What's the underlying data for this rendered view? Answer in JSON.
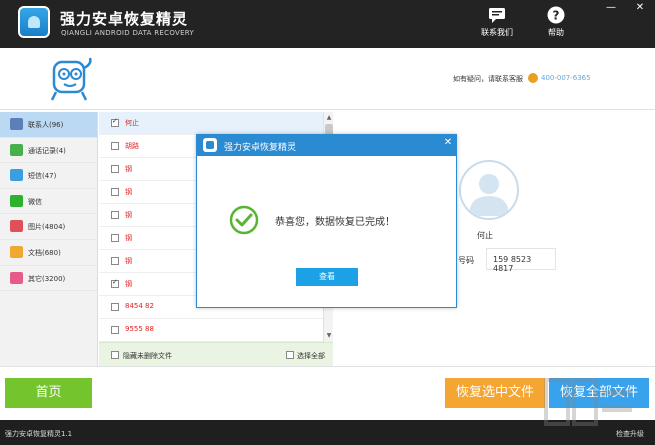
{
  "app": {
    "title": "强力安卓恢复精灵",
    "subtitle": "QIANGLI ANDROID DATA RECOVERY",
    "contact_label": "联系我们",
    "help_label": "帮助",
    "minimize": "—",
    "close": "✕"
  },
  "header": {
    "help_text": "如有疑问，请联系客服",
    "phone": "400-007-6365"
  },
  "sidebar": {
    "items": [
      {
        "label": "联系人(96)",
        "icon": "contacts-icon",
        "color": "#5b7fb8"
      },
      {
        "label": "通话记录(4)",
        "icon": "call-log-icon",
        "color": "#47b04b"
      },
      {
        "label": "短信(47)",
        "icon": "sms-icon",
        "color": "#3a9ee0"
      },
      {
        "label": "微信",
        "icon": "wechat-icon",
        "color": "#2fb12f"
      },
      {
        "label": "图片(4804)",
        "icon": "photos-icon",
        "color": "#e0505a"
      },
      {
        "label": "文档(680)",
        "icon": "documents-icon",
        "color": "#f0a830"
      },
      {
        "label": "其它(3200)",
        "icon": "others-icon",
        "color": "#e85a8a"
      }
    ]
  },
  "list": {
    "rows": [
      {
        "name": "何止",
        "checked": true
      },
      {
        "name": "胡路",
        "checked": false
      },
      {
        "name": "钢",
        "checked": false
      },
      {
        "name": "钢",
        "checked": false
      },
      {
        "name": "钢",
        "checked": false
      },
      {
        "name": "钢",
        "checked": false
      },
      {
        "name": "钢",
        "checked": false
      },
      {
        "name": "钢",
        "checked": true
      },
      {
        "name": "8454 82",
        "checked": false
      },
      {
        "name": "9555 88",
        "checked": false
      }
    ],
    "hide_deleted_label": "隐藏未删除文件",
    "select_all_label": "选择全部"
  },
  "detail": {
    "name": "何止",
    "phone_label": "号码",
    "phone_value": "159 8523 4817"
  },
  "buttons": {
    "home": "首页",
    "recover_selected": "恢复选中文件",
    "recover_all": "恢复全部文件"
  },
  "statusbar": {
    "version": "强力安卓恢复精灵1.1",
    "upgrade": "检查升级"
  },
  "dialog": {
    "title": "强力安卓恢复精灵",
    "message": "恭喜您，数据恢复已完成！",
    "ok": "查看",
    "close": "✕"
  },
  "colors": {
    "titlebar": "#232323",
    "accent_blue": "#2a8ad2",
    "green": "#73c42d",
    "orange": "#f5a531",
    "blue_button": "#38a2ec",
    "red_text": "#e02020"
  }
}
